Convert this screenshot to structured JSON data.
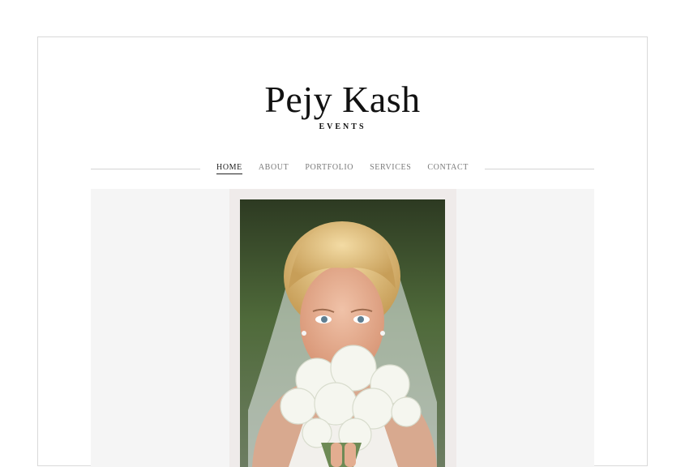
{
  "brand": {
    "name": "Pejy Kash",
    "subtitle": "EVENTS"
  },
  "nav": {
    "items": [
      {
        "label": "HOME",
        "active": true
      },
      {
        "label": "ABOUT"
      },
      {
        "label": "PORTFOLIO"
      },
      {
        "label": "SERVICES"
      },
      {
        "label": "CONTACT"
      }
    ]
  },
  "colors": {
    "page_bg": "#ffffff",
    "frame_border": "#d9d9d9",
    "hero_bg": "#f5f5f5",
    "nav_text": "#7a7a7a",
    "nav_active": "#222222"
  }
}
